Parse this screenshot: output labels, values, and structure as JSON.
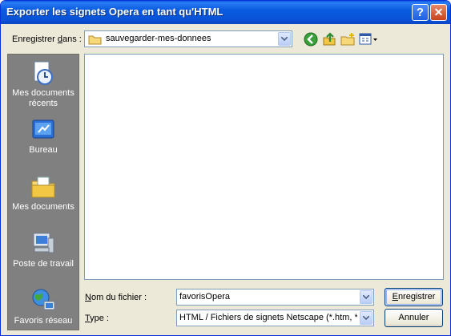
{
  "window": {
    "title": "Exporter les signets Opera en tant qu'HTML",
    "help_label": "?",
    "close_label": "✕"
  },
  "save_in": {
    "label_prefix": "Enregistrer ",
    "label_underline": "d",
    "label_suffix": "ans :",
    "folder": "sauvegarder-mes-donnees"
  },
  "toolbar": {
    "icons": [
      "back-icon",
      "up-folder-icon",
      "new-folder-icon",
      "view-menu-icon"
    ]
  },
  "places": [
    {
      "label": "Mes documents récents",
      "icon": "recent-documents-icon"
    },
    {
      "label": "Bureau",
      "icon": "desktop-icon"
    },
    {
      "label": "Mes documents",
      "icon": "my-documents-icon"
    },
    {
      "label": "Poste de travail",
      "icon": "my-computer-icon"
    },
    {
      "label": "Favoris réseau",
      "icon": "network-places-icon"
    }
  ],
  "filename": {
    "label_underline": "N",
    "label_rest": "om du fichier :",
    "value": "favorisOpera"
  },
  "filetype": {
    "label_underline": "T",
    "label_rest": "ype :",
    "value": "HTML / Fichiers de signets Netscape (*.htm, *.h"
  },
  "buttons": {
    "save_underline": "E",
    "save_rest": "nregistrer",
    "cancel": "Annuler"
  }
}
